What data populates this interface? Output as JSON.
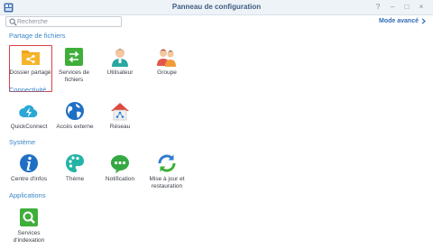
{
  "window": {
    "title": "Panneau de configuration",
    "controls": [
      "?",
      "–",
      "□",
      "×"
    ]
  },
  "toolbar": {
    "search_placeholder": "Recherche",
    "advanced_mode_label": "Mode avancé"
  },
  "sections": [
    {
      "title": "Partage de fichiers",
      "items": [
        {
          "label": "Dossier partagé",
          "icon": "shared-folder-icon",
          "selected": true
        },
        {
          "label": "Services de fichiers",
          "icon": "file-services-icon"
        },
        {
          "label": "Utilisateur",
          "icon": "user-icon"
        },
        {
          "label": "Groupe",
          "icon": "group-icon"
        }
      ]
    },
    {
      "title": "Connectivité",
      "items": [
        {
          "label": "QuickConnect",
          "icon": "quickconnect-icon"
        },
        {
          "label": "Accès externe",
          "icon": "external-access-icon"
        },
        {
          "label": "Réseau",
          "icon": "network-icon"
        }
      ]
    },
    {
      "title": "Système",
      "items": [
        {
          "label": "Centre d'infos",
          "icon": "info-center-icon"
        },
        {
          "label": "Thème",
          "icon": "theme-icon"
        },
        {
          "label": "Notification",
          "icon": "notification-icon"
        },
        {
          "label": "Mise à jour et restauration",
          "icon": "update-restore-icon"
        }
      ]
    },
    {
      "title": "Applications",
      "items": [
        {
          "label": "Services d'indexation",
          "icon": "indexing-service-icon"
        }
      ]
    }
  ],
  "colors": {
    "accent": "#3b86c7",
    "selection_border": "#d94141",
    "title_text": "#3f5b82"
  }
}
